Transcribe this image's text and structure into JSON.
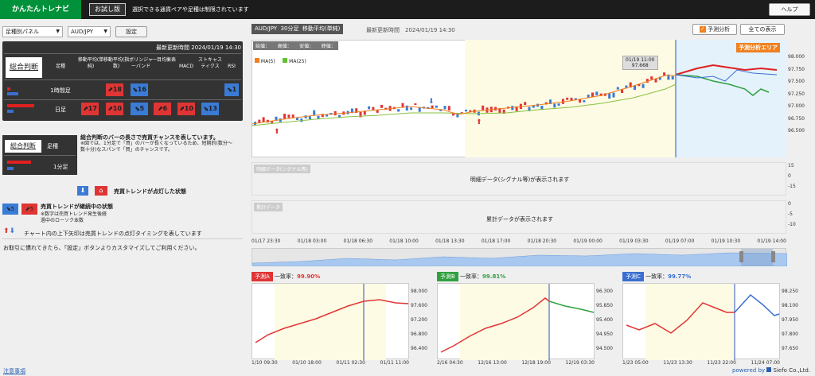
{
  "header": {
    "logo": "かんたんトレナビ",
    "trial_badge": "お試し版",
    "notice": "選択できる通貨ペアや足種は制限されています",
    "help": "ヘルプ"
  },
  "controls": {
    "panel_select": "足種別パネル",
    "pair_select": "AUD/JPY",
    "settings": "設定"
  },
  "summary": {
    "updated": "最新更新時間 2024/01/19 14:30",
    "overall_label": "総合判断",
    "leg_header": "足種",
    "indicators": [
      "移動平均(単純)",
      "移動平均(指数)",
      "ボリンジャーバンド",
      "一目均衡表",
      "MACD",
      "ストキャスティクス",
      "RSI"
    ],
    "rows": [
      {
        "leg": "1時間足",
        "signals": [
          {
            "index": 1,
            "value": "18",
            "dir": "up",
            "color": "red"
          },
          {
            "index": 2,
            "value": "16",
            "dir": "down",
            "color": "blue"
          },
          {
            "index": 6,
            "value": "1",
            "dir": "down",
            "color": "blue"
          }
        ]
      },
      {
        "leg": "日足",
        "signals": [
          {
            "index": 0,
            "value": "17",
            "dir": "up",
            "color": "red"
          },
          {
            "index": 1,
            "value": "10",
            "dir": "up",
            "color": "red"
          },
          {
            "index": 2,
            "value": "5",
            "dir": "down",
            "color": "blue"
          },
          {
            "index": 3,
            "value": "6",
            "dir": "up",
            "color": "red"
          },
          {
            "index": 4,
            "value": "10",
            "dir": "up",
            "color": "red"
          },
          {
            "index": 5,
            "value": "13",
            "dir": "down",
            "color": "blue"
          }
        ]
      }
    ]
  },
  "legend": {
    "overall_label": "総合判断",
    "leg_header": "足種",
    "leg": "1分足",
    "desc1": "総合判断のバーの長さで売買チャンスを表しています。",
    "desc2": "※図では、1分足で「買」のバーが長くなっているため、短期的(数分〜数十分)なスパンで「買」のチャンスです。",
    "lit_text": "売買トレンドが点灯した状態",
    "continue_text": "売買トレンドが継続中の状態",
    "continue_note1": "※数字は売買トレンド発生後経",
    "continue_note2": "過中のローソク本数",
    "continue_val_blue": "5",
    "continue_val_red": "5",
    "arrow_text": "チャート内の上下矢印は売買トレンドの点灯タイミングを表しています",
    "trade_note": "お取引に慣れてきたら、「設定」ボタンよりカスタマイズしてご利用ください。"
  },
  "chart": {
    "pair_tab": "AUD/JPY",
    "period_tab": "30分足",
    "indicator_tab": "移動平均(単純)",
    "updated": "最新更新時間　2024/01/19 14:30",
    "forecast_btn": "予測分析",
    "show_all_btn": "全ての表示",
    "ohlc": [
      "始値：",
      "高値：",
      "安値：",
      "終値："
    ],
    "ma_legend": [
      {
        "name": "MA(5)",
        "color": "#f08020"
      },
      {
        "name": "MA(25)",
        "color": "#60c030"
      }
    ],
    "forecast_area": "予測分析エリア",
    "tooltip_time": "01/19 11:00",
    "tooltip_value": "97.668",
    "y_ticks": [
      "98.000",
      "97.750",
      "97.500",
      "97.250",
      "97.000",
      "96.750",
      "96.500"
    ],
    "sub1_label": "明細データ(シグナル等)",
    "sub1_text": "明細データ(シグナル等)が表示されます",
    "sub1_ticks": [
      "15",
      "0",
      "-15"
    ],
    "sub2_label": "累計データ",
    "sub2_text": "累計データが表示されます",
    "sub2_ticks": [
      "0",
      "-5",
      "-10"
    ],
    "x_ticks": [
      "01/17 23:30",
      "01/18 03:00",
      "01/18 06:30",
      "01/18 10:00",
      "01/18 13:30",
      "01/18 17:00",
      "01/18 20:30",
      "01/19 00:00",
      "01/19 03:30",
      "01/19 07:00",
      "01/19 10:30",
      "01/19 14:00"
    ]
  },
  "forecasts": [
    {
      "label": "予測A",
      "rate_label": "一致率：",
      "rate": "99.90%",
      "label_color": "#e03535",
      "rate_color": "#e03535",
      "y_ticks": [
        "98.000",
        "97.600",
        "97.200",
        "96.800",
        "96.400"
      ],
      "x_ticks": [
        "1/10 09:30",
        "01/10 18:00",
        "01/11 02:30",
        "01/11 11:00"
      ]
    },
    {
      "label": "予測B",
      "rate_label": "一致率：",
      "rate": "99.81%",
      "label_color": "#30a040",
      "rate_color": "#30a040",
      "y_ticks": [
        "96.300",
        "95.850",
        "95.400",
        "94.950",
        "94.500"
      ],
      "x_ticks": [
        "2/16 04:30",
        "12/16 13:00",
        "12/18 19:00",
        "12/19 03:30"
      ]
    },
    {
      "label": "予測C",
      "rate_label": "一致率：",
      "rate": "99.77%",
      "label_color": "#3a6fd0",
      "rate_color": "#3a6fd0",
      "y_ticks": [
        "98.250",
        "98.100",
        "97.950",
        "97.800",
        "97.650"
      ],
      "x_ticks": [
        "1/23 05:00",
        "11/23 13:30",
        "11/23 22:00",
        "11/24 07:00"
      ]
    }
  ],
  "footer": {
    "notes": "注意事項",
    "powered": "powered by",
    "company": "Siefo Co.,Ltd."
  },
  "colors": {
    "brand": "#00913a",
    "up": "#e03535",
    "down": "#3a7bd5"
  }
}
